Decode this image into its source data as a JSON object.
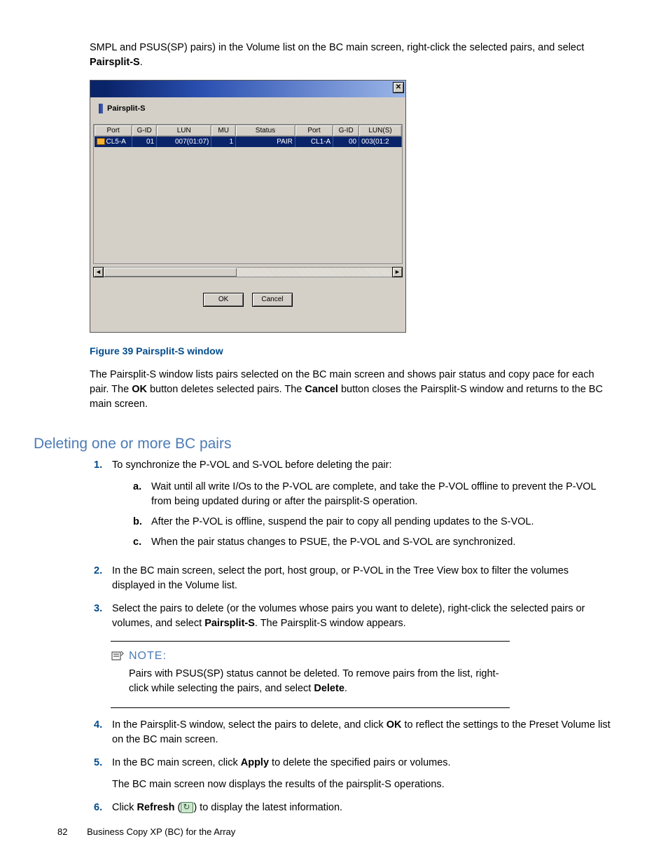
{
  "intro": {
    "part1": "SMPL and PSUS(SP) pairs) in the Volume list on the BC main screen, right-click the selected pairs, and select ",
    "bold": "Pairsplit-S",
    "part2": "."
  },
  "dialog": {
    "title": "Pairsplit-S",
    "close": "✕",
    "headers": [
      "Port",
      "G-ID",
      "LUN",
      "MU",
      "Status",
      "Port",
      "G-ID",
      "LUN(S)"
    ],
    "row": [
      "CL5-A",
      "01",
      "007(01:07)",
      "1",
      "PAIR",
      "CL1-A",
      "00",
      "003(01:2"
    ],
    "ok": "OK",
    "cancel": "Cancel"
  },
  "figure_caption": "Figure 39 Pairsplit-S window",
  "desc": {
    "p1a": "The Pairsplit-S window lists pairs selected on the BC main screen and shows pair status and copy pace for each pair. The ",
    "ok_bold": "OK",
    "p1b": " button deletes selected pairs. The ",
    "cancel_bold": "Cancel",
    "p1c": " button closes the Pairsplit-S window and returns to the BC main screen."
  },
  "section_title": "Deleting one or more BC pairs",
  "steps": {
    "s1": {
      "n": "1.",
      "text": "To synchronize the P-VOL and S-VOL before deleting the pair:"
    },
    "sub": {
      "a": {
        "l": "a.",
        "text": "Wait until all write I/Os to the P-VOL are complete, and take the P-VOL offline to prevent the P-VOL from being updated during or after the pairsplit-S operation."
      },
      "b": {
        "l": "b.",
        "text": "After the P-VOL is offline, suspend the pair to copy all pending updates to the S-VOL."
      },
      "c": {
        "l": "c.",
        "text": "When the pair status changes to PSUE, the P-VOL and S-VOL are synchronized."
      }
    },
    "s2": {
      "n": "2.",
      "text": "In the BC main screen, select the port, host group, or P-VOL in the Tree View box to filter the volumes displayed in the Volume list."
    },
    "s3": {
      "n": "3.",
      "t1": "Select the pairs to delete (or the volumes whose pairs you want to delete), right-click the selected pairs or volumes, and select ",
      "bold": "Pairsplit-S",
      "t2": ". The Pairsplit-S window appears."
    },
    "s4": {
      "n": "4.",
      "t1": "In the Pairsplit-S window, select the pairs to delete, and click ",
      "bold": "OK",
      "t2": " to reflect the settings to the Preset Volume list on the BC main screen."
    },
    "s5": {
      "n": "5.",
      "t1": "In the BC main screen, click ",
      "bold": "Apply",
      "t2": " to delete the specified pairs or volumes.",
      "after": "The BC main screen now displays the results of the pairsplit-S operations."
    },
    "s6": {
      "n": "6.",
      "t1": "Click ",
      "bold": "Refresh",
      "t2": " (",
      "t3": ") to display the latest information."
    }
  },
  "note": {
    "label": "NOTE:",
    "t1": "Pairs with PSUS(SP) status cannot be deleted. To remove pairs from the list, right-click while selecting the pairs, and select ",
    "bold": "Delete",
    "t2": "."
  },
  "footer": {
    "page": "82",
    "title": "Business Copy XP (BC) for the Array"
  }
}
